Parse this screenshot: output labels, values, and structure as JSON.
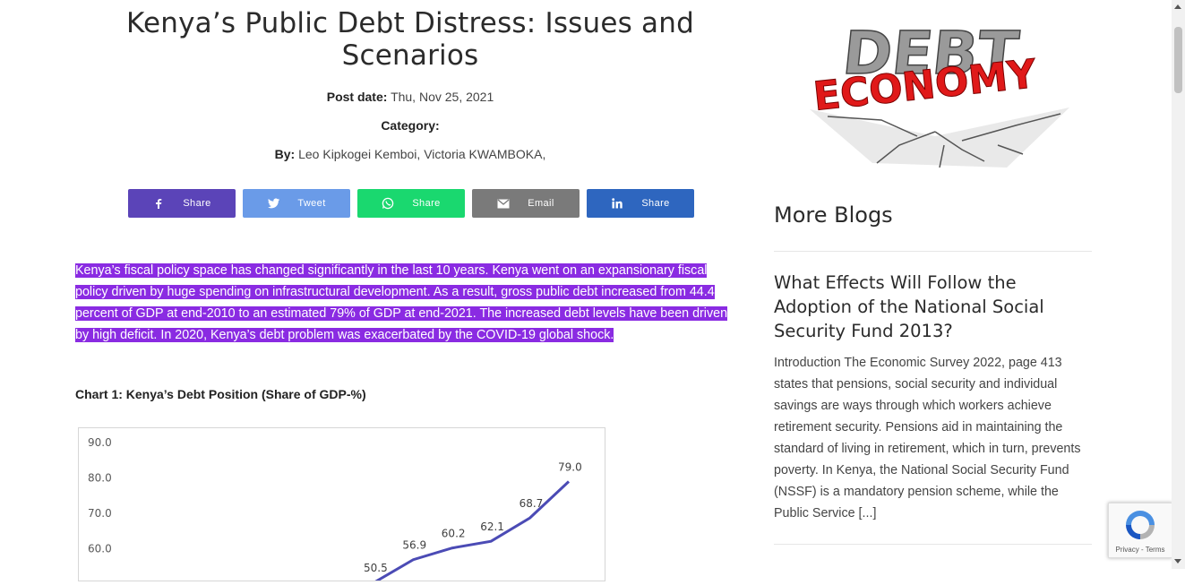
{
  "article": {
    "title": "Kenya’s Public Debt Distress: Issues and Scenarios",
    "post_date_label": "Post date:",
    "post_date": "Thu, Nov 25, 2021",
    "category_label": "Category:",
    "by_label": "By:",
    "authors": "Leo Kipkogei Kemboi, Victoria KWAMBOKA,",
    "intro": "Kenya’s fiscal policy space has changed significantly in the last 10 years. Kenya went on an expansionary fiscal policy driven by huge spending on infrastructural development. As a result, gross public debt increased from 44.4 percent of GDP at end-2010 to an estimated 79%  of GDP at end-2021. The increased debt levels have been driven by high deficit. In 2020, Kenya’s debt problem was exacerbated by the COVID-19 global shock.",
    "chart_heading": "Chart 1: Kenya’s Debt Position (Share of GDP-%)"
  },
  "share": [
    {
      "label": "Share",
      "icon": "facebook-icon",
      "color": "#5b44b8"
    },
    {
      "label": "Tweet",
      "icon": "twitter-icon",
      "color": "#6a9be8"
    },
    {
      "label": "Share",
      "icon": "whatsapp-icon",
      "color": "#1ad86f"
    },
    {
      "label": "Email",
      "icon": "email-icon",
      "color": "#7a7a7a"
    },
    {
      "label": "Share",
      "icon": "linkedin-icon",
      "color": "#2e66bf"
    }
  ],
  "chart_data": {
    "type": "line",
    "y_ticks": [
      "90.0",
      "80.0",
      "70.0",
      "60.0"
    ],
    "ylim": [
      50,
      90
    ],
    "values": [
      50.5,
      56.9,
      60.2,
      62.1,
      68.7,
      79.0
    ],
    "labels": [
      "50.5",
      "56.9",
      "60.2",
      "62.1",
      "68.7",
      "79.0"
    ],
    "line_color": "#4b4bb5"
  },
  "sidebar": {
    "image_text": [
      "DEBT",
      "ECONOMY"
    ],
    "more_blogs": "More Blogs",
    "post_title": "What Effects Will Follow the Adoption of the National Social Security Fund 2013?",
    "post_excerpt": "Introduction The Economic Survey 2022, page 413 states that pensions, social security and individual savings are ways through which workers achieve retirement security. Pensions aid in maintaining the standard of living in retirement, which in turn, prevents poverty. In Kenya, the National Social Security Fund (NSSF) is a mandatory pension scheme, while the Public Service [...]"
  },
  "recaptcha": {
    "links": "Privacy - Terms"
  },
  "colors": {
    "highlight": "#8a2be2"
  }
}
